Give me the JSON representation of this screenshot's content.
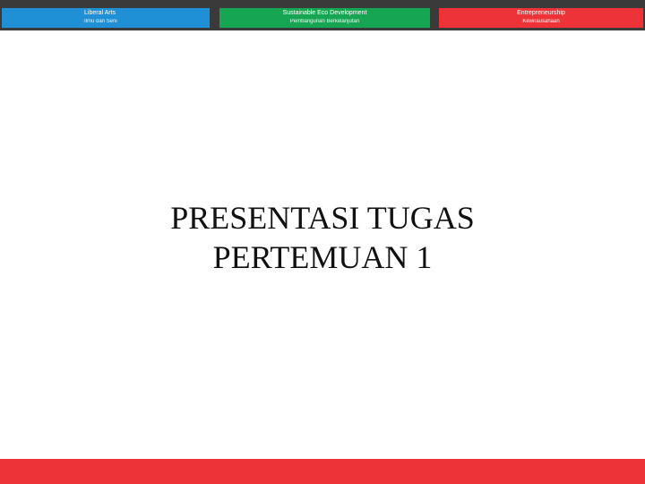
{
  "header": {
    "pillars": [
      {
        "name": "Liberal Arts",
        "subtitle": "Ilmu dan Seni",
        "color": "#1f8fd6"
      },
      {
        "name": "Sustainable Eco Development",
        "subtitle": "Pembangunan Berkelanjutan",
        "color": "#16a653"
      },
      {
        "name": "Entrepreneurship",
        "subtitle": "Kewirausahaan",
        "color": "#ee3338"
      }
    ]
  },
  "slide": {
    "title_line1": "PRESENTASI TUGAS",
    "title_line2": "PERTEMUAN 1"
  },
  "footer": {
    "color": "#ee3338"
  }
}
